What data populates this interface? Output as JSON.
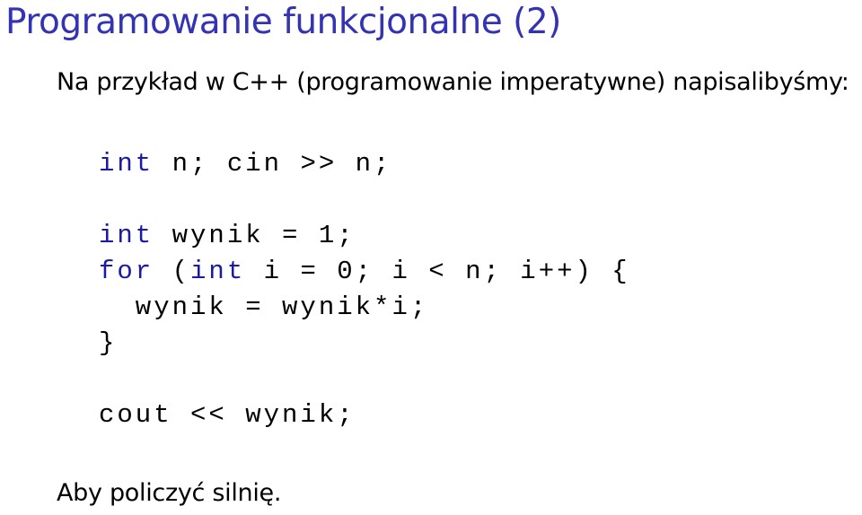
{
  "slide": {
    "title": "Programowanie funkcjonalne (2)",
    "intro": "Na przykład w C++ (programowanie imperatywne) napisalibyśmy:",
    "outro": "Aby policzyć silnię."
  },
  "code": {
    "line1": {
      "kw": "int",
      "rest": " n; cin >> n;"
    },
    "line2": {
      "kw": "int",
      "rest": " wynik = 1;"
    },
    "line3": {
      "kw1": "for",
      "mid": " (",
      "kw2": "int",
      "rest": " i = 0; i < n; i++) {"
    },
    "line4": {
      "text": "  wynik = wynik*i;"
    },
    "line5": {
      "text": "}"
    },
    "line6": {
      "text": "cout << wynik;"
    }
  },
  "colors": {
    "title": "#3333b3",
    "keyword": "#1a1aa6"
  }
}
